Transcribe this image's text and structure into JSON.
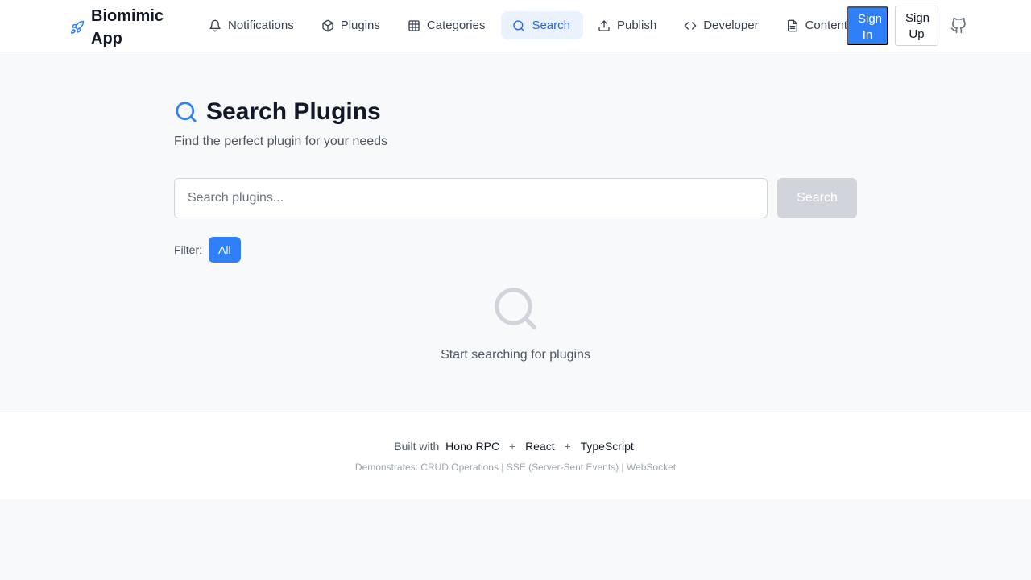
{
  "brand": {
    "name": "Biomimic App",
    "icon": "rocket-icon"
  },
  "nav": {
    "items": [
      {
        "label": "Notifications",
        "icon": "bell-icon"
      },
      {
        "label": "Plugins",
        "icon": "package-icon"
      },
      {
        "label": "Categories",
        "icon": "grid-icon"
      },
      {
        "label": "Search",
        "icon": "search-icon",
        "active": true
      },
      {
        "label": "Publish",
        "icon": "upload-icon"
      },
      {
        "label": "Developer",
        "icon": "code-icon"
      },
      {
        "label": "Content",
        "icon": "file-text-icon"
      }
    ],
    "sign_in": "Sign In",
    "sign_up": "Sign Up",
    "github_icon": "github-icon"
  },
  "page": {
    "title": "Search Plugins",
    "subtitle": "Find the perfect plugin for your needs",
    "search_placeholder": "Search plugins...",
    "search_value": "",
    "search_button": "Search",
    "filter_label": "Filter:",
    "filters": [
      "All"
    ],
    "active_filter": "All",
    "empty_text": "Start searching for plugins"
  },
  "footer": {
    "built_with": "Built with",
    "techs": [
      "Hono RPC",
      "React",
      "TypeScript"
    ],
    "plus": "+",
    "demonstrates": "Demonstrates: CRUD Operations | SSE (Server-Sent Events) | WebSocket"
  },
  "colors": {
    "accent": "#2f80f8",
    "active_nav_bg": "#eaf2fe",
    "background": "#f8f9fb"
  }
}
